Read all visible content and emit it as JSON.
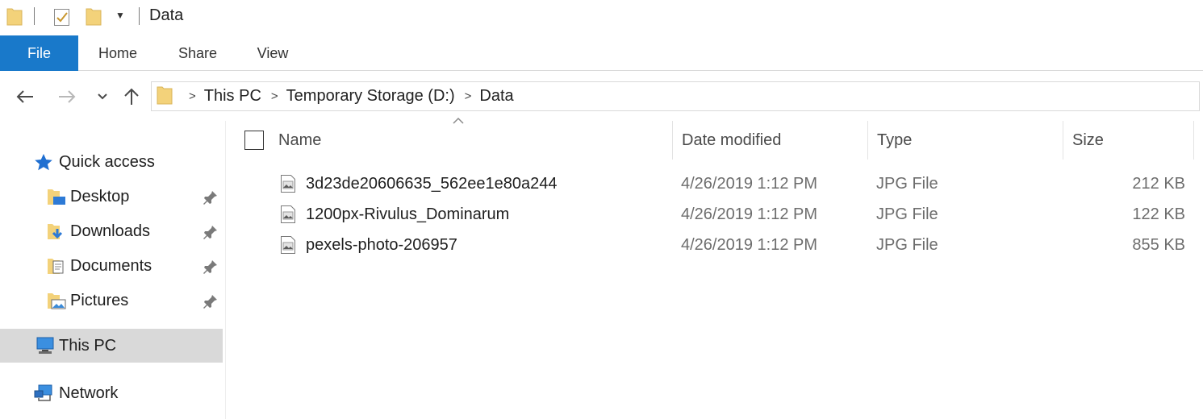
{
  "window": {
    "title": "Data"
  },
  "ribbon": {
    "tabs": [
      "File",
      "Home",
      "Share",
      "View"
    ]
  },
  "address": {
    "breadcrumb": [
      "This PC",
      "Temporary Storage (D:)",
      "Data"
    ]
  },
  "sidebar": {
    "items": [
      {
        "label": "Quick access",
        "icon": "star-icon"
      },
      {
        "label": "Desktop",
        "icon": "desktop-folder-icon",
        "pinned": true
      },
      {
        "label": "Downloads",
        "icon": "downloads-folder-icon",
        "pinned": true
      },
      {
        "label": "Documents",
        "icon": "documents-folder-icon",
        "pinned": true
      },
      {
        "label": "Pictures",
        "icon": "pictures-folder-icon",
        "pinned": true
      },
      {
        "label": "This PC",
        "icon": "computer-icon",
        "selected": true
      },
      {
        "label": "Network",
        "icon": "network-icon"
      }
    ]
  },
  "columns": [
    "Name",
    "Date modified",
    "Type",
    "Size"
  ],
  "files": [
    {
      "name": "3d23de20606635_562ee1e80a244",
      "date": "4/26/2019 1:12 PM",
      "type": "JPG File",
      "size": "212 KB"
    },
    {
      "name": "1200px-Rivulus_Dominarum",
      "date": "4/26/2019 1:12 PM",
      "type": "JPG File",
      "size": "122 KB"
    },
    {
      "name": "pexels-photo-206957",
      "date": "4/26/2019 1:12 PM",
      "type": "JPG File",
      "size": "855 KB"
    }
  ],
  "colors": {
    "accent": "#1979ca",
    "selection": "#d9d9d9",
    "folder": "#f3d27a"
  }
}
